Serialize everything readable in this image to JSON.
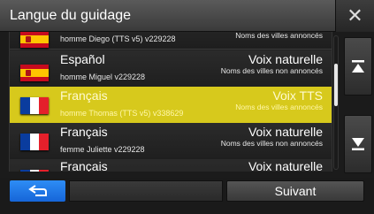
{
  "window": {
    "title": "Langue du guidage",
    "close_icon": "close-icon"
  },
  "list": {
    "items": [
      {
        "language": "",
        "voice": "homme Diego (TTS v5) v229228",
        "type": "",
        "towns": "Noms des villes annoncés",
        "flag": "es",
        "selected": false
      },
      {
        "language": "Español",
        "voice": "homme Miguel v229228",
        "type": "Voix naturelle",
        "towns": "Noms des villes non annoncés",
        "flag": "es",
        "selected": false
      },
      {
        "language": "Français",
        "voice": "homme Thomas (TTS v5) v338629",
        "type": "Voix TTS",
        "towns": "Noms des villes annoncés",
        "flag": "fr",
        "selected": true
      },
      {
        "language": "Français",
        "voice": "femme Juliette v229228",
        "type": "Voix naturelle",
        "towns": "Noms des villes non annoncés",
        "flag": "fr",
        "selected": false
      },
      {
        "language": "Français",
        "voice": "",
        "type": "Voix naturelle",
        "towns": "",
        "flag": "fr",
        "selected": false
      }
    ]
  },
  "scroll": {
    "up_icon": "scroll-top-icon",
    "down_icon": "scroll-down-icon"
  },
  "footer": {
    "back_icon": "back-arrow-icon",
    "next_label": "Suivant"
  },
  "colors": {
    "selected_row": "#d7c91c",
    "back_button": "#1e78e6"
  }
}
